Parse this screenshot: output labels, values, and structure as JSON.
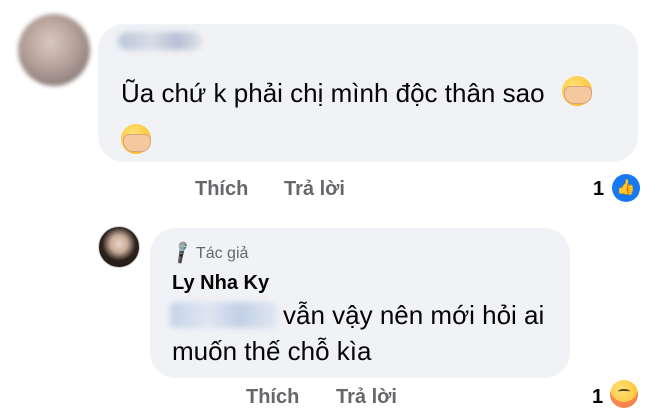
{
  "comment1": {
    "author_name": "",
    "text": "Ũa chứ k phải chị mình độc thân sao",
    "emoji": "face-palm-emoji",
    "actions": {
      "like_label": "Thích",
      "reply_label": "Trả lời"
    },
    "reaction_count": "1",
    "reaction_icon": "like-icon"
  },
  "comment2": {
    "badge_label": "Tác giả",
    "badge_icon": "microphone-icon",
    "author_name": "Ly Nha Ky",
    "text_line1": "vẫn vậy nên mới hỏi ai",
    "text_line2": "muốn thế chỗ kìa",
    "actions": {
      "like_label": "Thích",
      "reply_label": "Trả lời"
    },
    "reaction_count": "1",
    "reaction_icon": "care-reaction-icon"
  },
  "colors": {
    "bubble_bg": "#f0f2f5",
    "secondary_text": "#65676b",
    "like_blue": "#1877f2"
  }
}
